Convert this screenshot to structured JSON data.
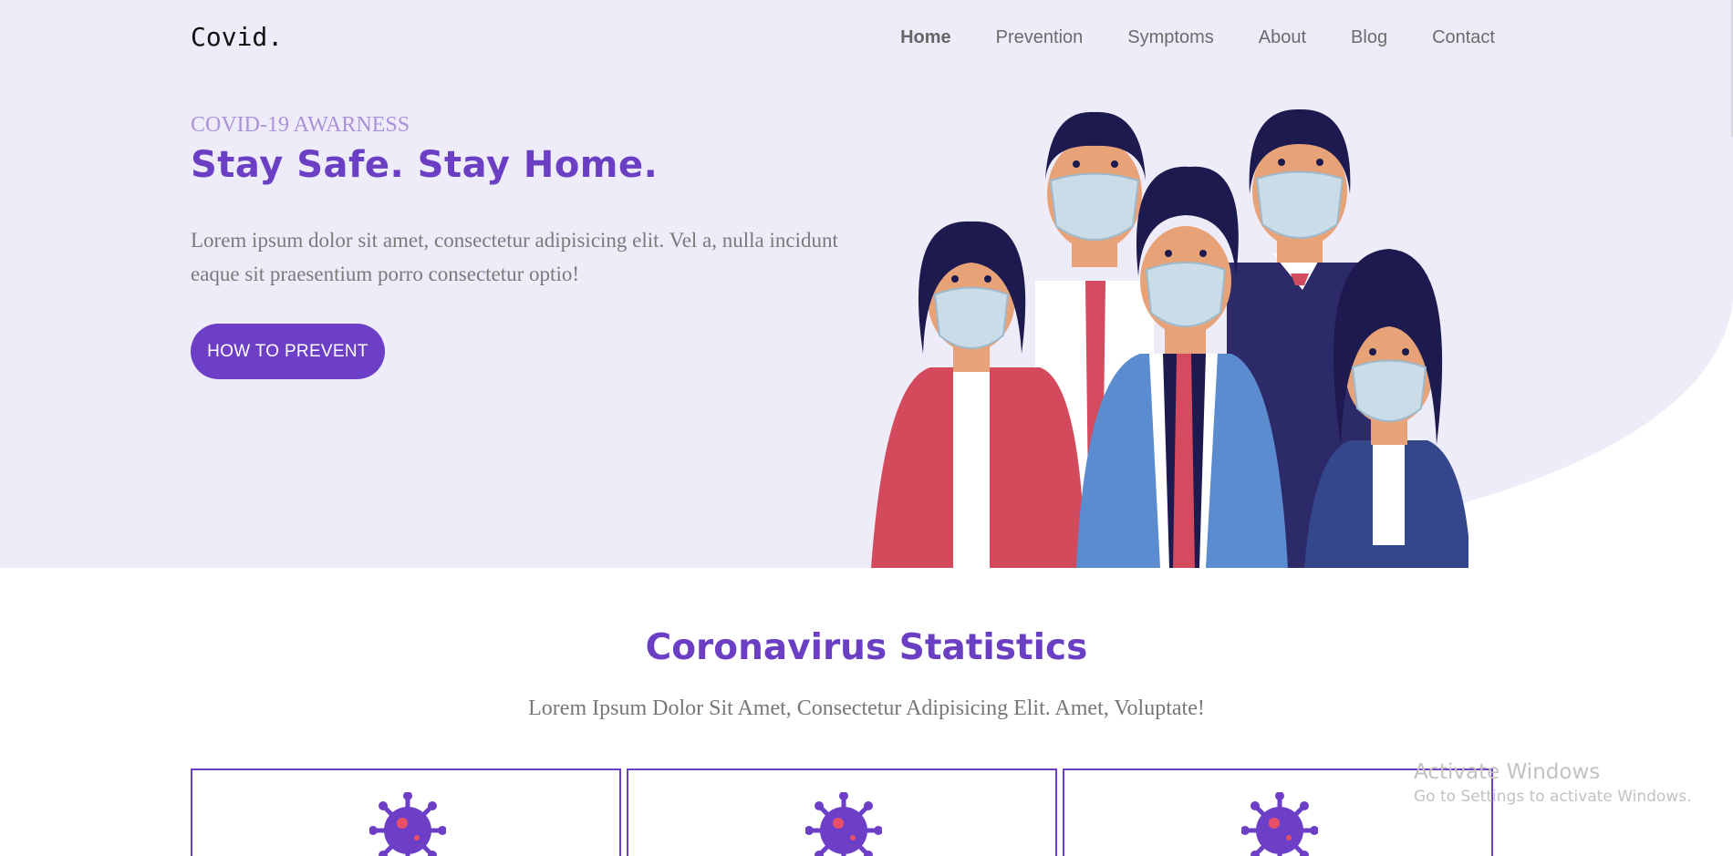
{
  "header": {
    "logo": "Covid.",
    "nav": [
      "Home",
      "Prevention",
      "Symptoms",
      "About",
      "Blog",
      "Contact"
    ]
  },
  "hero": {
    "eyebrow": "COVID-19 AWARNESS",
    "headline": "Stay Safe. Stay Home.",
    "lead": "Lorem ipsum dolor sit amet, consectetur adipisicing elit. Vel a, nulla incidunt eaque sit praesentium porro consectetur optio!",
    "cta": "HOW TO PREVENT",
    "illustration": "group-of-people-wearing-face-masks"
  },
  "stats": {
    "title": "Coronavirus Statistics",
    "subtitle": "Lorem Ipsum Dolor Sit Amet, Consectetur Adipisicing Elit. Amet, Voluptate!",
    "cards": [
      {
        "icon": "virus-icon"
      },
      {
        "icon": "virus-icon"
      },
      {
        "icon": "virus-icon"
      }
    ]
  },
  "watermark": {
    "line1": "Activate Windows",
    "line2": "Go to Settings to activate Windows."
  },
  "colors": {
    "hero_bg": "#efecf9",
    "accent": "#6d3fc6",
    "eyebrow": "#a892d8"
  }
}
